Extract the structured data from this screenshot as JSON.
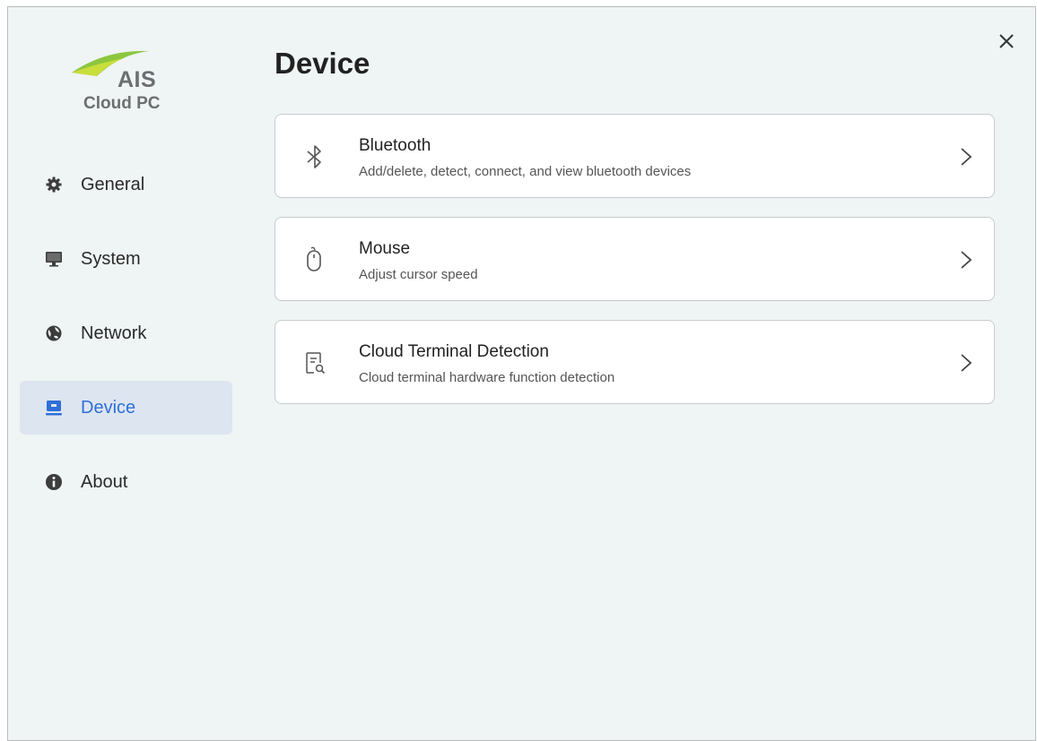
{
  "logo": {
    "brand": "AIS",
    "product": "Cloud PC"
  },
  "window": {
    "close_icon": "close-icon"
  },
  "sidebar": {
    "items": [
      {
        "label": "General",
        "icon": "gear-icon"
      },
      {
        "label": "System",
        "icon": "monitor-icon"
      },
      {
        "label": "Network",
        "icon": "network-icon"
      },
      {
        "label": "Device",
        "icon": "device-icon",
        "active": true
      },
      {
        "label": "About",
        "icon": "info-icon"
      }
    ]
  },
  "main": {
    "title": "Device",
    "cards": [
      {
        "title": "Bluetooth",
        "description": "Add/delete, detect, connect, and view bluetooth devices",
        "icon": "bluetooth-icon"
      },
      {
        "title": "Mouse",
        "description": "Adjust cursor speed",
        "icon": "mouse-icon"
      },
      {
        "title": "Cloud Terminal Detection",
        "description": "Cloud terminal hardware function detection",
        "icon": "detection-icon"
      }
    ]
  },
  "colors": {
    "accent": "#2f6fd8",
    "active_bg": "#dde5f1",
    "window_bg": "#eff4f4",
    "logo_green": "#8dc63f"
  }
}
